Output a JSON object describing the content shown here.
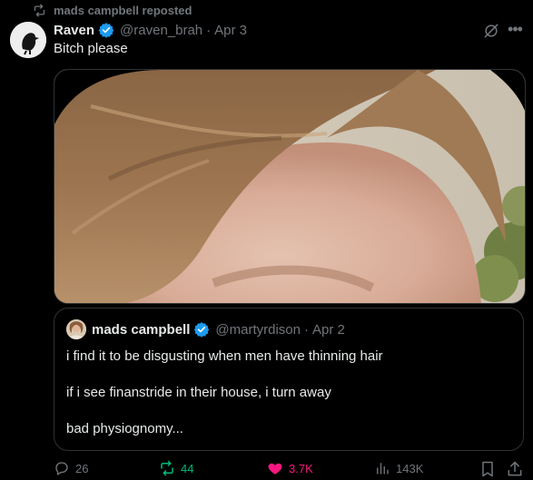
{
  "repost": {
    "text": "mads campbell reposted"
  },
  "post": {
    "author_name": "Raven",
    "author_handle": "@raven_brah",
    "date": "Apr 3",
    "text": "Bitch please"
  },
  "quote": {
    "author_name": "mads campbell",
    "author_handle": "@martyrdison",
    "date": "Apr 2",
    "lines": [
      "i find it to be disgusting when men have thinning hair",
      "if i see finanstride in their house, i turn away",
      "bad physiognomy..."
    ]
  },
  "actions": {
    "replies": "26",
    "reposts": "44",
    "likes": "3.7K",
    "views": "143K"
  },
  "colors": {
    "accent_verified": "#1d9bf0",
    "repost_green": "#00ba7c",
    "like_pink": "#f91880",
    "muted": "#71767b"
  }
}
